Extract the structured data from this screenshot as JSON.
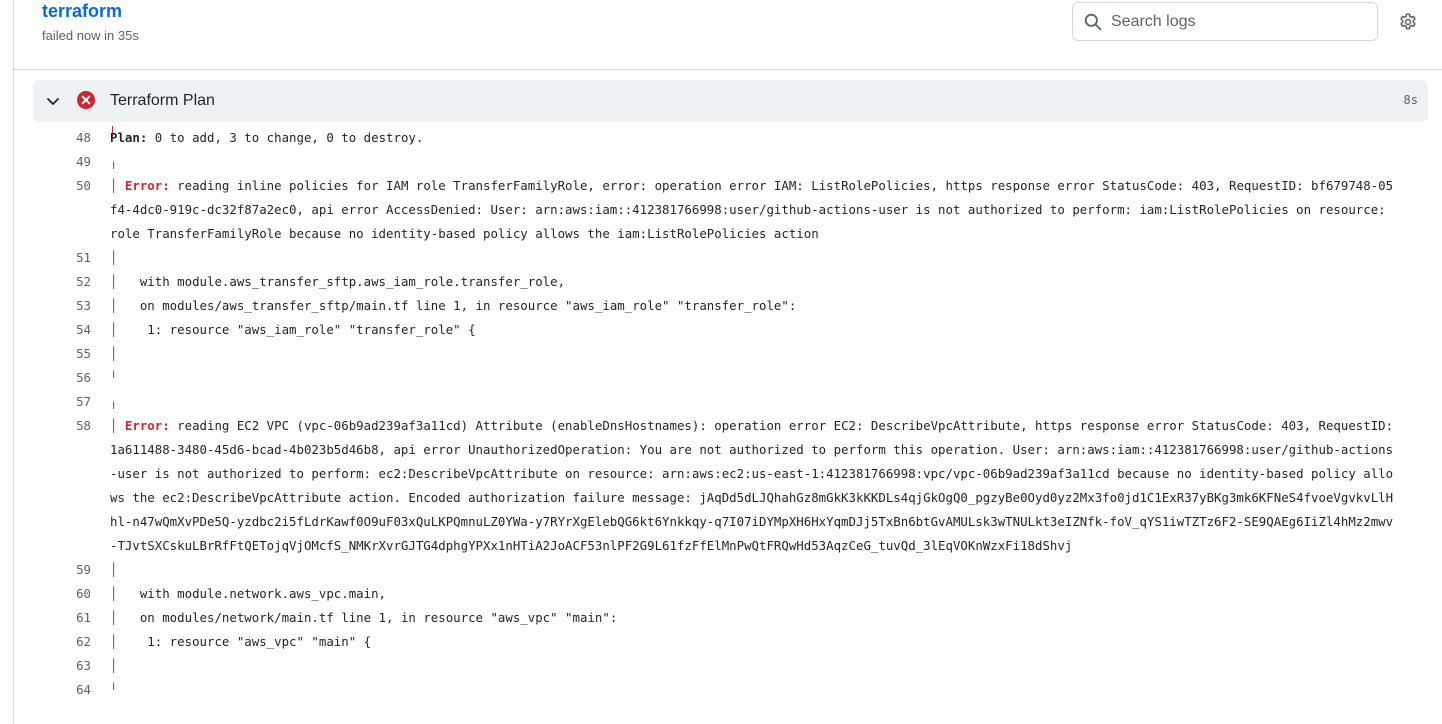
{
  "header": {
    "job_title": "terraform",
    "job_status": "failed now in 35s",
    "search_placeholder": "Search logs"
  },
  "step": {
    "name": "Terraform Plan",
    "duration": "8s",
    "status": "failed"
  },
  "colors": {
    "link": "#0969da",
    "error": "#d1242f",
    "muted": "#59636e",
    "step_bg": "#eff2f5"
  },
  "icons": {
    "search": "search-icon",
    "settings": "gear-icon",
    "collapse": "chevron-down-icon",
    "failed": "x-circle-fill-icon"
  },
  "log_lines": [
    {
      "n": "48",
      "bold": "Plan:",
      "text": " 0 to add, 3 to change, 0 to destroy."
    },
    {
      "n": "49",
      "bar": "╷",
      "text": ""
    },
    {
      "n": "50",
      "bar": "│",
      "err": " Error:",
      "text": " reading inline policies for IAM role TransferFamilyRole, error: operation error IAM: ListRolePolicies, https response error StatusCode: 403, RequestID: bf679748-05f4-4dc0-919c-dc32f87a2ec0, api error AccessDenied: User: arn:aws:iam::412381766998:user/github-actions-user is not authorized to perform: iam:ListRolePolicies on resource: role TransferFamilyRole because no identity-based policy allows the iam:ListRolePolicies action"
    },
    {
      "n": "51",
      "bar": "│",
      "text": ""
    },
    {
      "n": "52",
      "bar": "│",
      "text": "   with module.aws_transfer_sftp.aws_iam_role.transfer_role,"
    },
    {
      "n": "53",
      "bar": "│",
      "text": "   on modules/aws_transfer_sftp/main.tf line 1, in resource \"aws_iam_role\" \"transfer_role\":"
    },
    {
      "n": "54",
      "bar": "│",
      "text": "    1: resource \"aws_iam_role\" \"transfer_role\" {"
    },
    {
      "n": "55",
      "bar": "│",
      "text": ""
    },
    {
      "n": "56",
      "bar": "╵",
      "text": ""
    },
    {
      "n": "57",
      "bar": "╷",
      "text": ""
    },
    {
      "n": "58",
      "bar": "│",
      "err": " Error:",
      "text": " reading EC2 VPC (vpc-06b9ad239af3a11cd) Attribute (enableDnsHostnames): operation error EC2: DescribeVpcAttribute, https response error StatusCode: 403, RequestID: 1a611488-3480-45d6-bcad-4b023b5d46b8, api error UnauthorizedOperation: You are not authorized to perform this operation. User: arn:aws:iam::412381766998:user/github-actions-user is not authorized to perform: ec2:DescribeVpcAttribute on resource: arn:aws:ec2:us-east-1:412381766998:vpc/vpc-06b9ad239af3a11cd because no identity-based policy allows the ec2:DescribeVpcAttribute action. Encoded authorization failure message: jAqDd5dLJQhahGz8mGkK3kKKDLs4qjGkOgQ0_pgzyBe0Oyd0yz2Mx3fo0jd1C1ExR37yBKg3mk6KFNeS4fvoeVgvkvLlHhl-n47wQmXvPDe5Q-yzdbc2i5fLdrKawf0O9uF03xQuLKPQmnuLZ0YWa-y7RYrXgElebQG6kt6Ynkkqy-q7I07iDYMpXH6HxYqmDJj5TxBn6btGvAMULsk3wTNULkt3eIZNfk-foV_qYS1iwTZTz6F2-SE9QAEg6IiZl4hMz2mwv-TJvtSXCskuLBrRfFtQETojqVjOMcfS_NMKrXvrGJTG4dphgYPXx1nHTiA2JoACF53nlPF2G9L61fzFfElMnPwQtFRQwHd53AqzCeG_tuvQd_3lEqVOKnWzxFi18dShvj"
    },
    {
      "n": "59",
      "bar": "│",
      "text": ""
    },
    {
      "n": "60",
      "bar": "│",
      "text": "   with module.network.aws_vpc.main,"
    },
    {
      "n": "61",
      "bar": "│",
      "text": "   on modules/network/main.tf line 1, in resource \"aws_vpc\" \"main\":"
    },
    {
      "n": "62",
      "bar": "│",
      "text": "    1: resource \"aws_vpc\" \"main\" {"
    },
    {
      "n": "63",
      "bar": "│",
      "text": ""
    },
    {
      "n": "64",
      "bar": "╵",
      "text": ""
    }
  ]
}
